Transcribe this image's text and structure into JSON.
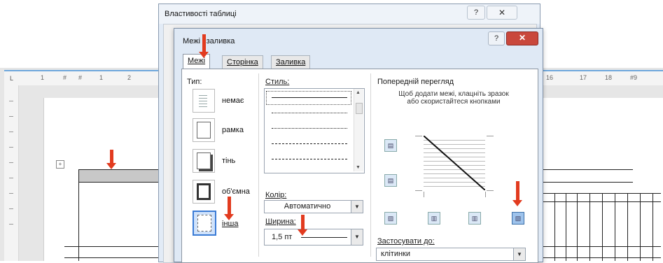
{
  "ruler": {
    "numbers": [
      "1",
      "#",
      "#",
      "1",
      "2",
      "16",
      "17",
      "18",
      "#9"
    ]
  },
  "table_properties": {
    "title": "Властивості таблиці",
    "help": "?",
    "close": "✕"
  },
  "borders_dialog": {
    "title": "Межі і заливка",
    "help": "?",
    "close": "✕",
    "tabs": [
      {
        "label": "Межі"
      },
      {
        "label": "Сторінка"
      },
      {
        "label": "Заливка"
      }
    ],
    "setting": {
      "label": "Тип:",
      "items": [
        {
          "label": "немає"
        },
        {
          "label": "рамка"
        },
        {
          "label": "тінь"
        },
        {
          "label": "об'ємна"
        },
        {
          "label": "інша"
        }
      ]
    },
    "style": {
      "label": "Стиль:"
    },
    "color": {
      "label": "Колір:",
      "value": "Автоматично"
    },
    "width": {
      "label": "Ширина:",
      "value": "1,5 пт"
    },
    "preview": {
      "label": "Попередній перегляд",
      "hint": "Щоб додати межі, клацніть зразок або скористайтеся кнопками"
    },
    "apply_to": {
      "label": "Застосувати до:",
      "value": "клітинки"
    }
  },
  "colors": {
    "accent_arrow": "#e23b1f",
    "ruler_border": "#6fa8dc",
    "close_button": "#c9483c"
  },
  "icons": [
    "table-move-icon",
    "help-icon",
    "close-icon",
    "dropdown-arrow-icon",
    "scroll-up-icon",
    "scroll-down-icon",
    "diagonal-border-icon"
  ]
}
